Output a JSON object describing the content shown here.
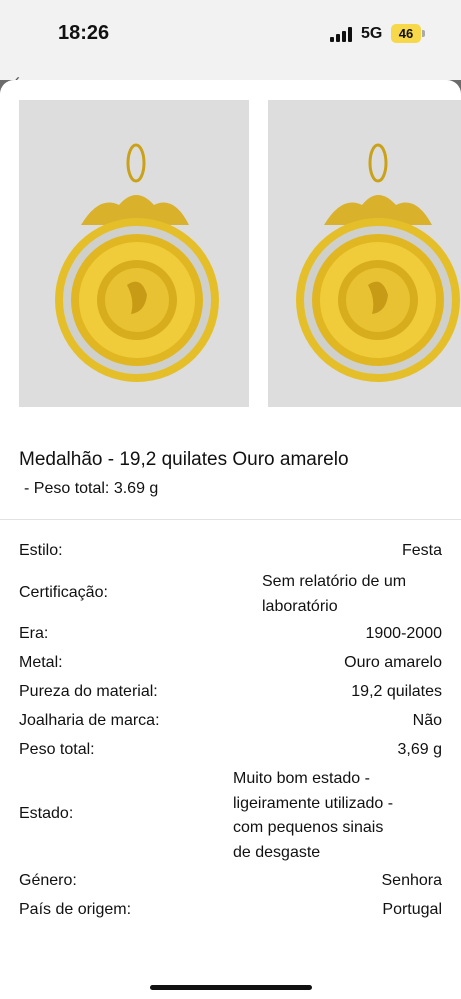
{
  "status_bar": {
    "time": "18:26",
    "network": "5G",
    "battery": "46",
    "battery_color": "#f6d84a"
  },
  "back_hint": "‹",
  "images": [
    {
      "name": "pendant-photo-front",
      "icon": "gold-medallion-pendant"
    },
    {
      "name": "pendant-photo-second",
      "icon": "gold-medallion-pendant"
    }
  ],
  "product": {
    "title": "Medalhão - 19,2 quilates Ouro amarelo",
    "subtitle": "- Peso total: 3.69 g"
  },
  "specs": [
    {
      "label": "Estilo:",
      "value": "Festa"
    },
    {
      "label": "Certificação:",
      "value_lines": [
        "Sem relatório de um",
        "laboratório"
      ]
    },
    {
      "label": "Era:",
      "value": "1900-2000"
    },
    {
      "label": "Metal:",
      "value": "Ouro amarelo"
    },
    {
      "label": "Pureza do material:",
      "value": "19,2 quilates"
    },
    {
      "label": "Joalharia de marca:",
      "value": "Não"
    },
    {
      "label": "Peso total:",
      "value": "3,69 g"
    },
    {
      "label": "Estado:",
      "value_lines": [
        "Muito bom estado -",
        "ligeiramente utilizado -",
        "com pequenos sinais",
        "de desgaste"
      ]
    },
    {
      "label": "Género:",
      "value": "Senhora"
    },
    {
      "label": "País de origem:",
      "value": "Portugal"
    }
  ]
}
